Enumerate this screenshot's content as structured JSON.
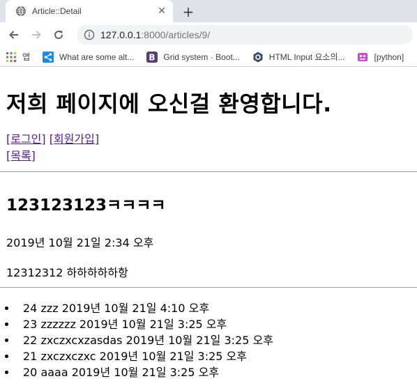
{
  "browser": {
    "tab_title": "Article::Detail",
    "new_tab_symbol": "+",
    "close_symbol": "✕",
    "url_host": "127.0.0.1",
    "url_path": ":8000/articles/9/",
    "bookmarks": [
      {
        "label": "앱",
        "icon": "apps-grid-icon"
      },
      {
        "label": "What are some alt...",
        "icon": "share-icon"
      },
      {
        "label": "Grid system · Boot...",
        "icon": "bootstrap-icon"
      },
      {
        "label": "HTML Input 요소의...",
        "icon": "hexagon-icon"
      },
      {
        "label": "[python]",
        "icon": "bracket-logo-icon"
      }
    ]
  },
  "page": {
    "heading": "저희 페이지에 오신걸 환영합니다.",
    "login_link": "[로그인]",
    "signup_link": "[회원가입]",
    "list_link": "[목록]",
    "article": {
      "title": "123123123ㅋㅋㅋㅋ",
      "date": "2019년 10월 21일 2:34 오후",
      "body": "12312312 하하하하하항"
    },
    "comments": [
      {
        "text": "24 zzz 2019년 10월 21일 4:10 오후"
      },
      {
        "text": "23 zzzzzz 2019년 10월 21일 3:25 오후"
      },
      {
        "text": "22 zxczxcxzasdas 2019년 10월 21일 3:25 오후"
      },
      {
        "text": "21 zxczxczxc 2019년 10월 21일 3:25 오후"
      },
      {
        "text": "20 aaaa 2019년 10월 21일 3:25 오후"
      }
    ]
  },
  "colors": {
    "tabbar_bg": "#dee1e6",
    "visited_link": "#551a8b",
    "url_path": "#70757a"
  }
}
